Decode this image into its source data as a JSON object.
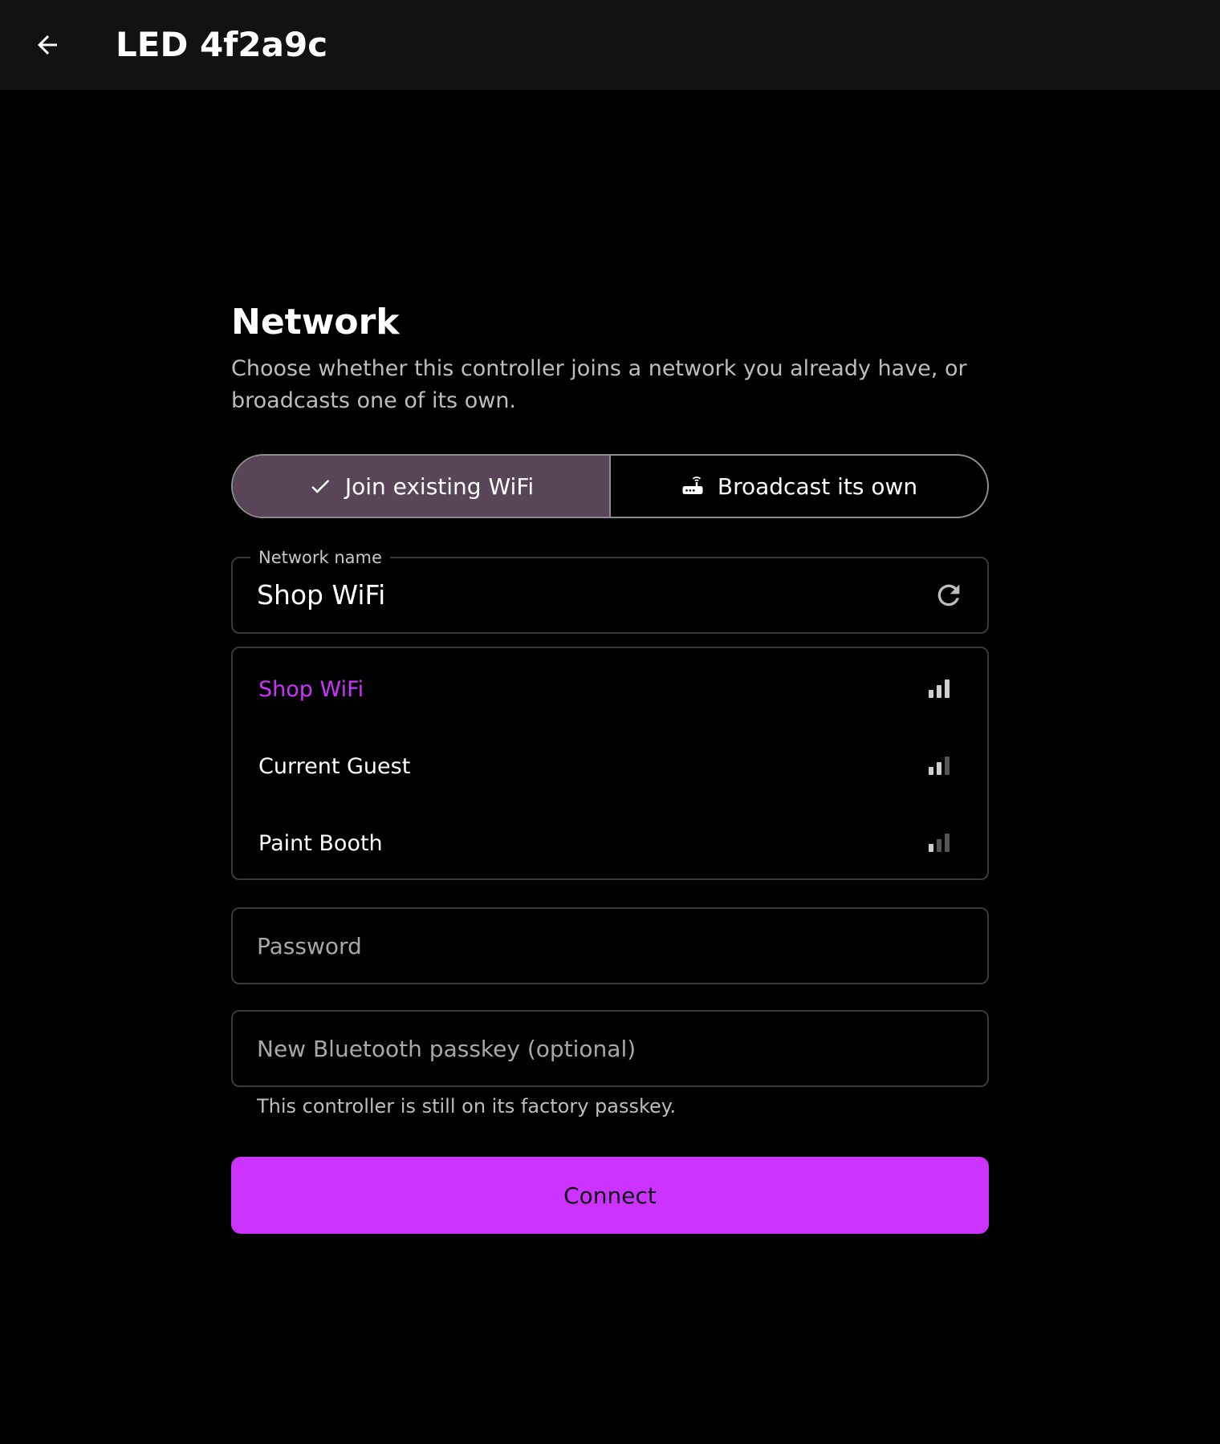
{
  "colors": {
    "accent": "#cc33ff",
    "appbar_bg": "#121212",
    "page_bg": "#000000",
    "segment_selected_bg": "#584658"
  },
  "appbar": {
    "back_icon": "arrow-left-icon",
    "title": "LED 4f2a9c"
  },
  "section": {
    "title": "Network",
    "description": "Choose whether this controller joins a network you already have, or broadcasts one of its own."
  },
  "mode_toggle": {
    "options": [
      {
        "label": "Join existing WiFi",
        "icon": "check-icon",
        "selected": true
      },
      {
        "label": "Broadcast its own",
        "icon": "router-icon",
        "selected": false
      }
    ]
  },
  "network_field": {
    "label": "Network name",
    "value": "Shop WiFi",
    "action_icon": "refresh-icon"
  },
  "networks": [
    {
      "name": "Shop WiFi",
      "signal_bars": 3,
      "selected": true
    },
    {
      "name": "Current Guest",
      "signal_bars": 2,
      "selected": false
    },
    {
      "name": "Paint Booth",
      "signal_bars": 1,
      "selected": false
    }
  ],
  "password_field": {
    "placeholder": "Password",
    "value": ""
  },
  "passkey_field": {
    "placeholder": "New Bluetooth passkey (optional)",
    "value": "",
    "helper": "This controller is still on its factory passkey."
  },
  "connect_button": {
    "label": "Connect"
  }
}
